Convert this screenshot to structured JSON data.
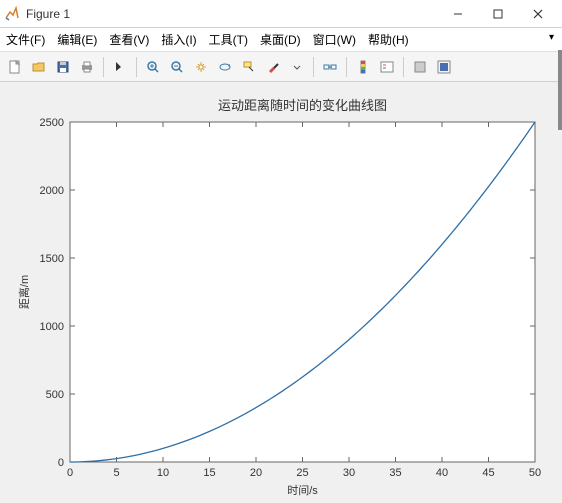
{
  "window": {
    "title": "Figure 1"
  },
  "menu": {
    "file": "文件(F)",
    "edit": "编辑(E)",
    "view": "查看(V)",
    "insert": "插入(I)",
    "tools": "工具(T)",
    "desktop": "桌面(D)",
    "window": "窗口(W)",
    "help": "帮助(H)"
  },
  "chart_data": {
    "type": "line",
    "title": "运动距离随时间的变化曲线图",
    "xlabel": "时间/s",
    "ylabel": "距离/m",
    "xlim": [
      0,
      50
    ],
    "ylim": [
      0,
      2500
    ],
    "xticks": [
      0,
      5,
      10,
      15,
      20,
      25,
      30,
      35,
      40,
      45,
      50
    ],
    "yticks": [
      0,
      500,
      1000,
      1500,
      2000,
      2500
    ],
    "x": [
      0,
      5,
      10,
      15,
      20,
      25,
      30,
      35,
      40,
      45,
      50
    ],
    "values": [
      0,
      25,
      100,
      225,
      400,
      625,
      900,
      1225,
      1600,
      2025,
      2500
    ],
    "series_color": "#2f6fa7"
  }
}
